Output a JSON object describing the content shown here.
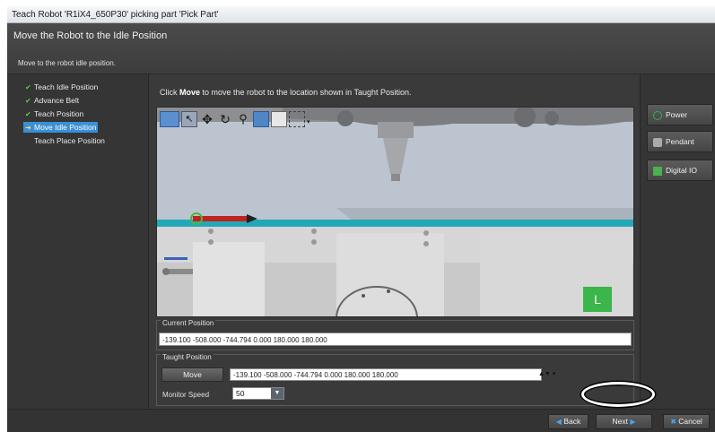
{
  "window": {
    "title": "Teach Robot 'R1iX4_650P30' picking part 'Pick Part'"
  },
  "header": {
    "title": "Move the Robot to the Idle Position",
    "subtitle": "Move to the robot idle position."
  },
  "steps": [
    {
      "label": "Teach Idle Position",
      "state": "done"
    },
    {
      "label": "Advance Belt",
      "state": "done"
    },
    {
      "label": "Teach Position",
      "state": "done"
    },
    {
      "label": "Move Idle Position",
      "state": "active"
    },
    {
      "label": "Teach Place Position",
      "state": "pending"
    }
  ],
  "instruction": {
    "pre": "Click ",
    "bold": "Move",
    "post": " to move the robot to the location shown in Taught Position."
  },
  "viewport": {
    "marker_label": "L"
  },
  "current_position": {
    "label": "Current Position",
    "value": "-139.100 -508.000 -744.794 0.000 180.000 180.000"
  },
  "taught_position": {
    "label": "Taught Position",
    "move_label": "Move",
    "value": "-139.100 -508.000 -744.794 0.000 180.000 180.000",
    "monitor_speed_label": "Monitor Speed",
    "monitor_speed_value": "50"
  },
  "right_panel": {
    "power": "Power",
    "pendant": "Pendant",
    "digital_io": "Digital IO"
  },
  "footer": {
    "back": "Back",
    "next": "Next",
    "cancel": "Cancel"
  },
  "colors": {
    "accent": "#3a8fd6",
    "check": "#6cc24a",
    "marker": "#3cb54a",
    "digital_io": "#4caf50"
  }
}
